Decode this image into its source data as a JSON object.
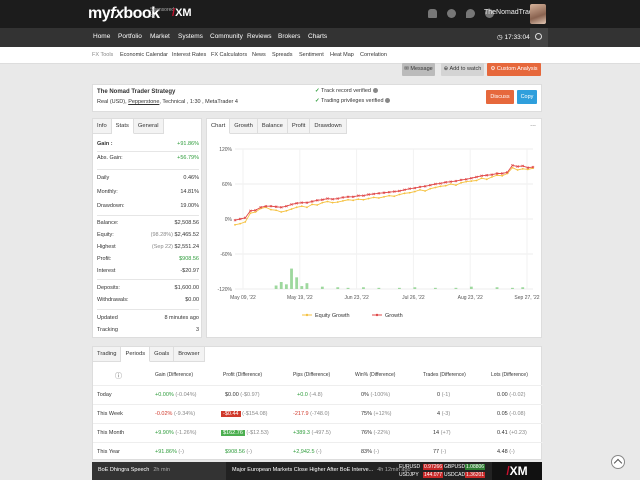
{
  "header": {
    "logo_part1": "my",
    "logo_part2": "fx",
    "logo_part3": "book",
    "sponsor_text": "Sponsored by",
    "sponsor_brand": "XM",
    "username": "TheNomadTrader"
  },
  "nav": {
    "items": [
      "Home",
      "Portfolio",
      "Market",
      "Systems",
      "Community",
      "Reviews",
      "Brokers",
      "Charts"
    ],
    "time": "17:33:04"
  },
  "subnav": {
    "items": [
      "FX Tools",
      "Economic Calendar",
      "Interest Rates",
      "FX Calculators",
      "News",
      "Spreads",
      "Sentiment",
      "Heat Map",
      "Correlation"
    ]
  },
  "actions": {
    "message": "Message",
    "add_to_watch": "Add to watch",
    "custom_analysis": "Custom Analysis",
    "discuss": "Discuss",
    "copy": "Copy"
  },
  "strategy": {
    "title": "The Nomad Trader Strategy",
    "sub_prefix": "Real (USD),",
    "broker": "Pepperstone",
    "sub_suffix": ", Technical , 1:30 , MetaTrader 4",
    "verify1": "Track record verified",
    "verify2": "Trading privileges verified"
  },
  "info_tabs": [
    "Info",
    "Stats",
    "General"
  ],
  "info": {
    "gain_label": "Gain :",
    "gain": "+91.86%",
    "abs_gain_label": "Abs. Gain:",
    "abs_gain": "+56.79%",
    "daily_label": "Daily",
    "daily": "0.46%",
    "monthly_label": "Monthly:",
    "monthly": "14.81%",
    "drawdown_label": "Drawdown:",
    "drawdown": "19.00%",
    "balance_label": "Balance:",
    "balance": "$2,508.56",
    "equity_label": "Equity:",
    "equity_pct": "(98.28%)",
    "equity": "$2,465.52",
    "highest_label": "Highest",
    "highest_date": "(Sep 22)",
    "highest": "$2,551.24",
    "profit_label": "Profit:",
    "profit": "$908.56",
    "interest_label": "Interest",
    "interest": "-$20.97",
    "deposits_label": "Deposits:",
    "deposits": "$1,600.00",
    "withdrawals_label": "Withdrawals:",
    "withdrawals": "$0.00",
    "updated_label": "Updated",
    "updated": "8 minutes ago",
    "tracking_label": "Tracking",
    "tracking": "3"
  },
  "chart_tabs": [
    "Chart",
    "Growth",
    "Balance",
    "Profit",
    "Drawdown"
  ],
  "chart_more": "...",
  "chart_data": {
    "type": "line",
    "y_ticks": [
      "120%",
      "60%",
      "0%",
      "-60%",
      "-120%"
    ],
    "ylim": [
      -120,
      120
    ],
    "x_ticks": [
      "May 09, '22",
      "May 19, '22",
      "Jun 23, '22",
      "Jul 26, '22",
      "Aug 23, '22",
      "Sep 27, '22"
    ],
    "legend": [
      "Equity Growth",
      "Growth"
    ],
    "series": [
      {
        "name": "Equity Growth",
        "color": "#f5c242",
        "values": [
          -10,
          -8,
          -5,
          10,
          12,
          18,
          20,
          16,
          15,
          12,
          14,
          17,
          20,
          22,
          20,
          25,
          24,
          28,
          30,
          28,
          29,
          31,
          33,
          32,
          34,
          33,
          35,
          37,
          36,
          38,
          40,
          39,
          42,
          44,
          45,
          47,
          50,
          48,
          52,
          54,
          56,
          57,
          60,
          58,
          62,
          64,
          65,
          66,
          70,
          68,
          72,
          75,
          74,
          78,
          88,
          84,
          86,
          85,
          87
        ]
      },
      {
        "name": "Growth",
        "color": "#e04848",
        "values": [
          -2,
          0,
          2,
          14,
          15,
          20,
          22,
          22,
          21,
          20,
          22,
          25,
          27,
          28,
          28,
          30,
          32,
          33,
          35,
          34,
          35,
          37,
          38,
          38,
          40,
          40,
          42,
          43,
          44,
          45,
          46,
          47,
          48,
          50,
          52,
          53,
          55,
          56,
          58,
          60,
          61,
          63,
          64,
          65,
          67,
          68,
          70,
          72,
          74,
          75,
          76,
          78,
          78,
          80,
          92,
          90,
          91,
          88,
          89
        ]
      }
    ],
    "bars": [
      0,
      0,
      0,
      0,
      0,
      0,
      0,
      0,
      6,
      12,
      8,
      35,
      20,
      5,
      10,
      0,
      0,
      4,
      0,
      0,
      3,
      0,
      2,
      0,
      0,
      3,
      0,
      0,
      2,
      0,
      0,
      0,
      2,
      0,
      0,
      3,
      0,
      0,
      0,
      2,
      0,
      0,
      0,
      2,
      0,
      0,
      4,
      0,
      0,
      0,
      0,
      3,
      0,
      0,
      2,
      0,
      3,
      0,
      0
    ],
    "bar_color": "#9ed89e"
  },
  "table_tabs": [
    "Trading",
    "Periods",
    "Goals",
    "Browser"
  ],
  "table": {
    "headers": [
      "Gain (Difference)",
      "Profit (Difference)",
      "Pips (Difference)",
      "Win% (Difference)",
      "Trades (Difference)",
      "Lots (Difference)"
    ],
    "rows": [
      {
        "label": "Today",
        "gain": "+0.00%",
        "gain_diff": "(-0.04%)",
        "profit": "$0.00",
        "profit_diff": "(-$0.97)",
        "pips": "+0.0",
        "pips_diff": "(-4.8)",
        "win": "0%",
        "win_diff": "(-100%)",
        "trades": "0",
        "trades_diff": "(-1)",
        "lots": "0.00",
        "lots_diff": "(-0.02)"
      },
      {
        "label": "This Week",
        "gain": "-0.02%",
        "gain_diff": "(-9.34%)",
        "profit": "-$0.44",
        "profit_diff": "(-$154.08)",
        "pips": "-217.9",
        "pips_diff": "(-748.0)",
        "win": "75%",
        "win_diff": "(+12%)",
        "trades": "4",
        "trades_diff": "(-3)",
        "lots": "0.05",
        "lots_diff": "(-0.08)"
      },
      {
        "label": "This Month",
        "gain": "+9.90%",
        "gain_diff": "(-1.26%)",
        "profit": "$162.76",
        "profit_diff": "(-$12.53)",
        "pips": "+389.3",
        "pips_diff": "(-497.5)",
        "win": "76%",
        "win_diff": "(-22%)",
        "trades": "14",
        "trades_diff": "(+7)",
        "lots": "0.41",
        "lots_diff": "(+0.23)"
      },
      {
        "label": "This Year",
        "gain": "+91.86%",
        "gain_diff": "(-)",
        "profit": "$908.56",
        "profit_diff": "(-)",
        "pips": "+2,942.5",
        "pips_diff": "(-)",
        "win": "83%",
        "win_diff": "(-)",
        "trades": "77",
        "trades_diff": "(-)",
        "lots": "4.48",
        "lots_diff": "(-)"
      }
    ]
  },
  "ticker": {
    "speech": "BoE Dhingra Speech",
    "speech_time": "2h min",
    "news": "Major European Markets Close Higher After BoE Interve...",
    "news_time": "4h 12min ago",
    "fx": [
      {
        "sym": "EURUSD",
        "p1": "0.97266",
        "sym2": "GBPUSD",
        "p2": "1.08806",
        "p2_up": true
      },
      {
        "sym": "USDJPY",
        "p1": "144.077",
        "sym2": "USDCAD",
        "p2": "1.36201",
        "p2_up": false
      }
    ],
    "brand": "XM"
  }
}
